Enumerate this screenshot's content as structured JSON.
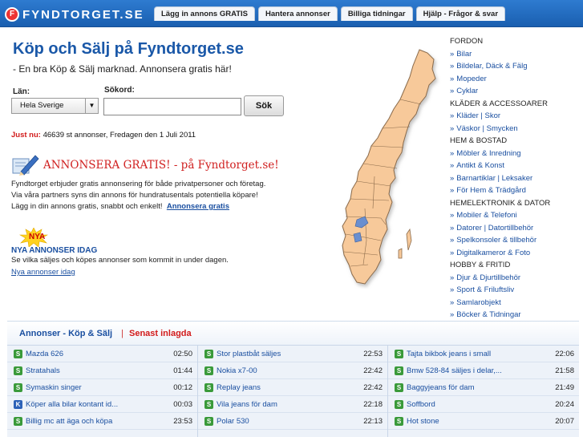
{
  "header": {
    "logo_text": "FYNDTORGET.SE",
    "logo_mark": "F",
    "tabs": [
      "Lägg in annons GRATIS",
      "Hantera annonser",
      "Billiga tidningar",
      "Hjälp - Frågor & svar"
    ]
  },
  "hero": {
    "title": "Köp och Sälj på Fyndtorget.se",
    "subtitle": "- En bra Köp & Sälj marknad. Annonsera gratis här!"
  },
  "search": {
    "lan_label": "Län:",
    "sokord_label": "Sökord:",
    "lan_value": "Hela Sverige",
    "query_value": "",
    "button_label": "Sök"
  },
  "status": {
    "prefix": "Just nu:",
    "text": " 46639 st annonser, Fredagen den 1 Juli 2011"
  },
  "promo": {
    "headline": "ANNONSERA GRATIS! - på Fyndtorget.se!",
    "line1": "Fyndtorget erbjuder gratis annonsering för både privatpersoner och företag.",
    "line2": "Via våra partners syns din annons för hundratusentals potentiella köpare!",
    "line3": "Lägg in din annons gratis, snabbt och enkelt!",
    "link": "Annonsera gratis"
  },
  "new_ads": {
    "badge": "NYA",
    "heading": "NYA ANNONSER IDAG",
    "text": "Se vilka säljes och köpes annonser som kommit in under dagen.",
    "link": "Nya annonser idag"
  },
  "categories": [
    {
      "heading": "FORDON",
      "items": [
        "Bilar",
        "Bildelar, Däck & Fälg",
        "Mopeder",
        "Cyklar"
      ]
    },
    {
      "heading": "KLÄDER & ACCESSOARER",
      "items": [
        "Kläder | Skor",
        "Väskor | Smycken"
      ]
    },
    {
      "heading": "HEM & BOSTAD",
      "items": [
        "Möbler & Inredning",
        "Antikt & Konst",
        "Barnartiklar | Leksaker",
        "För Hem & Trädgård"
      ]
    },
    {
      "heading": "HEMELEKTRONIK & DATOR",
      "items": [
        "Mobiler & Telefoni",
        "Datorer | Datortillbehör",
        "Spelkonsoler & tillbehör",
        "Digitalkameror & Foto"
      ]
    },
    {
      "heading": "HOBBY & FRITID",
      "items": [
        "Djur & Djurtillbehör",
        "Sport & Friluftsliv",
        "Samlarobjekt",
        "Böcker & Tidningar"
      ]
    }
  ],
  "listing": {
    "title": "Annonser - Köp & Sälj",
    "separator": "|",
    "recent_label": "Senast inlagda",
    "columns": [
      [
        {
          "type": "S",
          "title": "Mazda 626",
          "time": "02:50"
        },
        {
          "type": "S",
          "title": "Stratahals",
          "time": "01:44"
        },
        {
          "type": "S",
          "title": "Symaskin singer",
          "time": "00:12"
        },
        {
          "type": "K",
          "title": "Köper alla bilar kontant id...",
          "time": "00:03"
        },
        {
          "type": "S",
          "title": "Billig mc att äga och köpa",
          "time": "23:53"
        }
      ],
      [
        {
          "type": "S",
          "title": "Stor plastbåt säljes",
          "time": "22:53"
        },
        {
          "type": "S",
          "title": "Nokia x7-00",
          "time": "22:42"
        },
        {
          "type": "S",
          "title": "Replay jeans",
          "time": "22:42"
        },
        {
          "type": "S",
          "title": "Vila jeans för dam",
          "time": "22:18"
        },
        {
          "type": "S",
          "title": "Polar 530",
          "time": "22:13"
        }
      ],
      [
        {
          "type": "S",
          "title": "Tajta bikbok jeans i small",
          "time": "22:06"
        },
        {
          "type": "S",
          "title": "Bmw 528-84 säljes i delar,...",
          "time": "21:58"
        },
        {
          "type": "S",
          "title": "Baggyjeans för dam",
          "time": "21:49"
        },
        {
          "type": "S",
          "title": "Soffbord",
          "time": "20:24"
        },
        {
          "type": "S",
          "title": "Hot stone",
          "time": "20:07"
        }
      ]
    ]
  },
  "colors": {
    "brand_blue": "#1a5fb0",
    "link_blue": "#1a4fa0",
    "accent_red": "#d21b1b",
    "map_fill": "#f7c99a",
    "sell_badge": "#3a9a3a",
    "buy_badge": "#2d62b8"
  }
}
